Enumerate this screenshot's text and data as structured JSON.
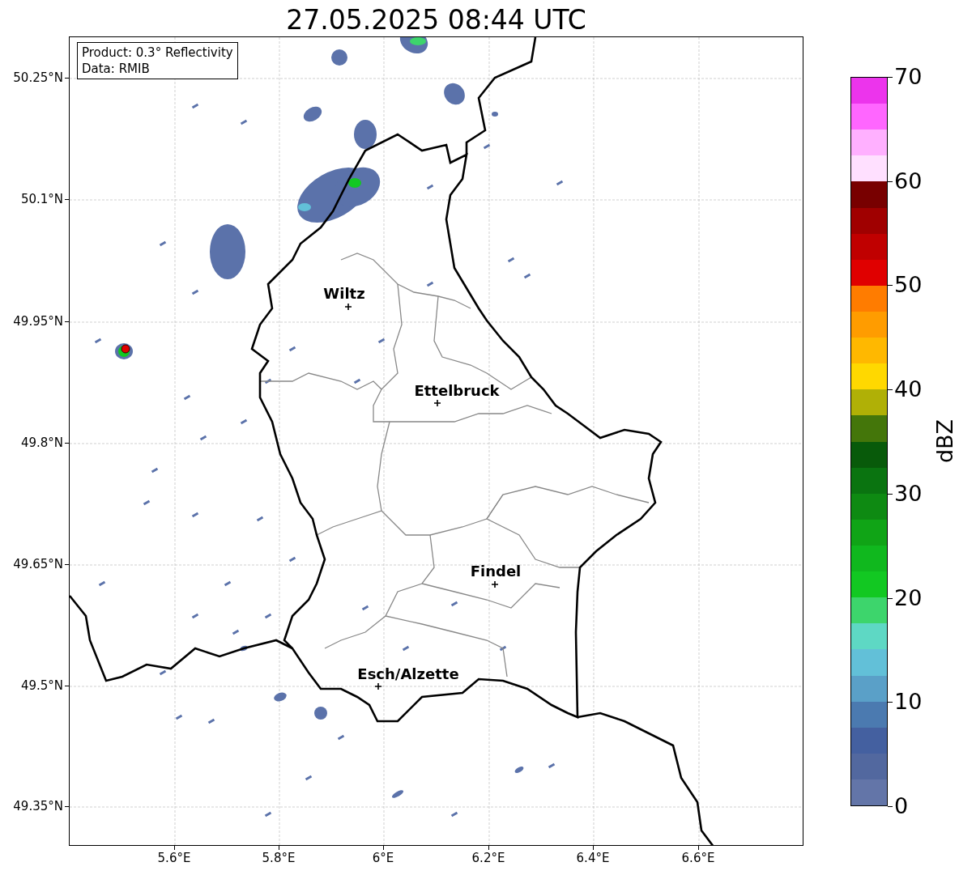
{
  "title": "27.05.2025 08:44 UTC",
  "map": {
    "info_lines": [
      "Product: 0.3° Reflectivity",
      "Data: RMIB"
    ],
    "x_ticks": [
      "5.6°E",
      "5.8°E",
      "6°E",
      "6.2°E",
      "6.4°E",
      "6.6°E"
    ],
    "y_ticks": [
      "50.25°N",
      "50.1°N",
      "49.95°N",
      "49.8°N",
      "49.65°N",
      "49.5°N",
      "49.35°N"
    ],
    "places": [
      {
        "name": "Wiltz"
      },
      {
        "name": "Ettelbruck"
      },
      {
        "name": "Findel"
      },
      {
        "name": "Esch/Alzette"
      }
    ]
  },
  "colorbar": {
    "label": "dBZ",
    "ticks": [
      "70",
      "60",
      "50",
      "40",
      "30",
      "20",
      "10",
      "0"
    ],
    "segments": [
      {
        "color": "#ec34ec"
      },
      {
        "color": "#ff66ff"
      },
      {
        "color": "#ffb0ff"
      },
      {
        "color": "#ffe0ff"
      },
      {
        "color": "#780000"
      },
      {
        "color": "#a00000"
      },
      {
        "color": "#c00000"
      },
      {
        "color": "#e00000"
      },
      {
        "color": "#ff7c00"
      },
      {
        "color": "#ff9c00"
      },
      {
        "color": "#ffb800"
      },
      {
        "color": "#ffd800"
      },
      {
        "color": "#b0b006"
      },
      {
        "color": "#44760a"
      },
      {
        "color": "#085a0a"
      },
      {
        "color": "#0a7410"
      },
      {
        "color": "#0e8a12"
      },
      {
        "color": "#10a416"
      },
      {
        "color": "#10b81e"
      },
      {
        "color": "#12c822"
      },
      {
        "color": "#3dd56c"
      },
      {
        "color": "#5ed8c4"
      },
      {
        "color": "#62c0d8"
      },
      {
        "color": "#5aa0c8"
      },
      {
        "color": "#4b7ab0"
      },
      {
        "color": "#4460a0"
      },
      {
        "color": "#52689f"
      },
      {
        "color": "#6375a8"
      }
    ]
  }
}
